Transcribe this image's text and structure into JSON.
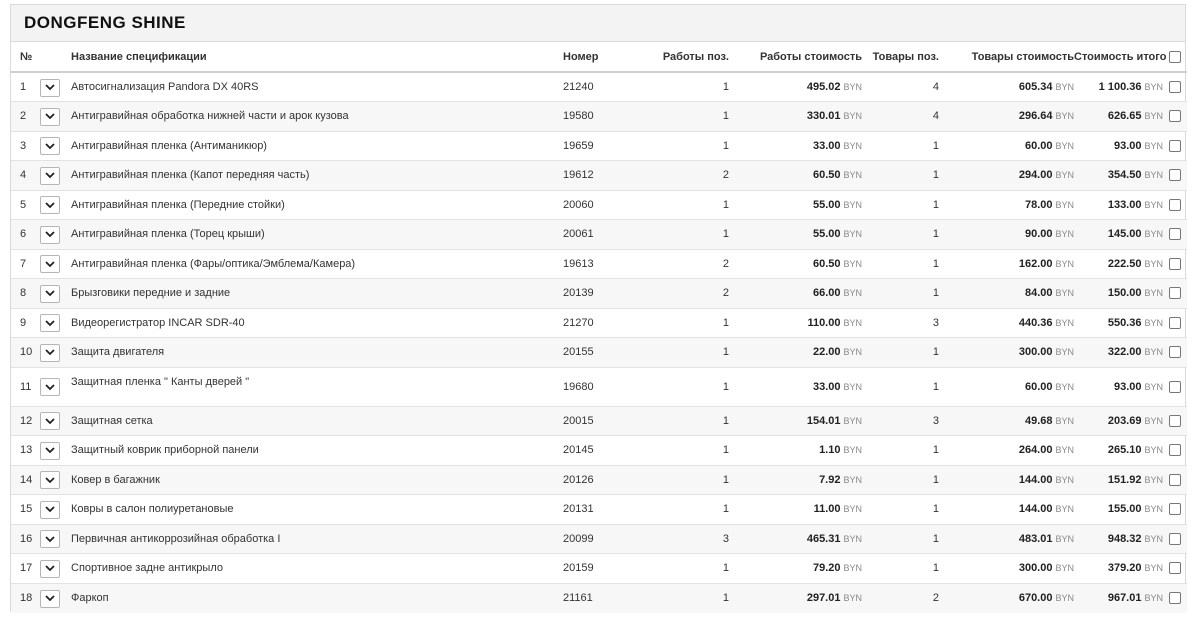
{
  "title": "DONGFENG SHINE",
  "currency": "BYN",
  "columns": {
    "num": "№",
    "name": "Название спецификации",
    "number": "Номер",
    "works_count": "Работы поз.",
    "works_cost": "Работы стоимость",
    "goods_count": "Товары поз.",
    "goods_cost": "Товары стоимость",
    "total": "Стоимость итого"
  },
  "rows": [
    {
      "n": "1",
      "name": "Автосигнализация Pandora DX 40RS",
      "number": "21240",
      "works_count": "1",
      "works_cost": "495.02",
      "goods_count": "4",
      "goods_cost": "605.34",
      "total": "1 100.36"
    },
    {
      "n": "2",
      "name": "Антигравийная обработка нижней части и арок кузова",
      "number": "19580",
      "works_count": "1",
      "works_cost": "330.01",
      "goods_count": "4",
      "goods_cost": "296.64",
      "total": "626.65"
    },
    {
      "n": "3",
      "name": "Антигравийная пленка (Антиманикюр)",
      "number": "19659",
      "works_count": "1",
      "works_cost": "33.00",
      "goods_count": "1",
      "goods_cost": "60.00",
      "total": "93.00"
    },
    {
      "n": "4",
      "name": "Антигравийная пленка (Капот передняя часть)",
      "number": "19612",
      "works_count": "2",
      "works_cost": "60.50",
      "goods_count": "1",
      "goods_cost": "294.00",
      "total": "354.50"
    },
    {
      "n": "5",
      "name": "Антигравийная пленка (Передние стойки)",
      "number": "20060",
      "works_count": "1",
      "works_cost": "55.00",
      "goods_count": "1",
      "goods_cost": "78.00",
      "total": "133.00"
    },
    {
      "n": "6",
      "name": "Антигравийная пленка (Торец крыши)",
      "number": "20061",
      "works_count": "1",
      "works_cost": "55.00",
      "goods_count": "1",
      "goods_cost": "90.00",
      "total": "145.00"
    },
    {
      "n": "7",
      "name": "Антигравийная пленка (Фары/оптика/Эмблема/Камера)",
      "number": "19613",
      "works_count": "2",
      "works_cost": "60.50",
      "goods_count": "1",
      "goods_cost": "162.00",
      "total": "222.50"
    },
    {
      "n": "8",
      "name": "Брызговики передние и задние",
      "number": "20139",
      "works_count": "2",
      "works_cost": "66.00",
      "goods_count": "1",
      "goods_cost": "84.00",
      "total": "150.00"
    },
    {
      "n": "9",
      "name": "Видеорегистратор INCAR SDR-40",
      "number": "21270",
      "works_count": "1",
      "works_cost": "110.00",
      "goods_count": "3",
      "goods_cost": "440.36",
      "total": "550.36"
    },
    {
      "n": "10",
      "name": "Защита двигателя",
      "number": "20155",
      "works_count": "1",
      "works_cost": "22.00",
      "goods_count": "1",
      "goods_cost": "300.00",
      "total": "322.00"
    },
    {
      "n": "11",
      "name": "Защитная пленка \" Канты дверей \"",
      "number": "19680",
      "works_count": "1",
      "works_cost": "33.00",
      "goods_count": "1",
      "goods_cost": "60.00",
      "total": "93.00",
      "tall": true
    },
    {
      "n": "12",
      "name": "Защитная сетка",
      "number": "20015",
      "works_count": "1",
      "works_cost": "154.01",
      "goods_count": "3",
      "goods_cost": "49.68",
      "total": "203.69"
    },
    {
      "n": "13",
      "name": "Защитный коврик приборной панели",
      "number": "20145",
      "works_count": "1",
      "works_cost": "1.10",
      "goods_count": "1",
      "goods_cost": "264.00",
      "total": "265.10"
    },
    {
      "n": "14",
      "name": "Ковер в багажник",
      "number": "20126",
      "works_count": "1",
      "works_cost": "7.92",
      "goods_count": "1",
      "goods_cost": "144.00",
      "total": "151.92"
    },
    {
      "n": "15",
      "name": "Ковры в салон полиуретановые",
      "number": "20131",
      "works_count": "1",
      "works_cost": "11.00",
      "goods_count": "1",
      "goods_cost": "144.00",
      "total": "155.00"
    },
    {
      "n": "16",
      "name": "Первичная антикоррозийная обработка І",
      "number": "20099",
      "works_count": "3",
      "works_cost": "465.31",
      "goods_count": "1",
      "goods_cost": "483.01",
      "total": "948.32"
    },
    {
      "n": "17",
      "name": "Спортивное задне антикрыло",
      "number": "20159",
      "works_count": "1",
      "works_cost": "79.20",
      "goods_count": "1",
      "goods_cost": "300.00",
      "total": "379.20"
    },
    {
      "n": "18",
      "name": "Фаркоп",
      "number": "21161",
      "works_count": "1",
      "works_cost": "297.01",
      "goods_count": "2",
      "goods_cost": "670.00",
      "total": "967.01"
    }
  ]
}
